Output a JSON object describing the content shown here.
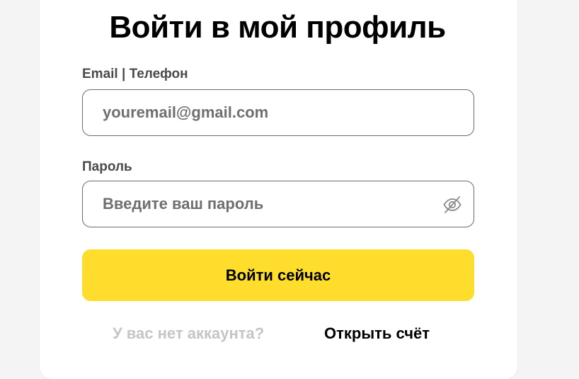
{
  "form": {
    "title": "Войти в мой профиль",
    "email_label": "Email | Телефон",
    "email_placeholder": "youremail@gmail.com",
    "password_label": "Пароль",
    "password_placeholder": "Введите ваш пароль",
    "password_toggle_icon": "eye-off-icon",
    "submit_label": "Войти сейчас",
    "no_account_text": "У вас нет аккаунта?",
    "open_account_link": "Открыть счёт"
  },
  "colors": {
    "page_background": "#f4f4f4",
    "card_background": "#ffffff",
    "accent_button": "#ffdd2d",
    "input_border": "#6b6b6b",
    "muted_text": "#c5c5c5"
  }
}
